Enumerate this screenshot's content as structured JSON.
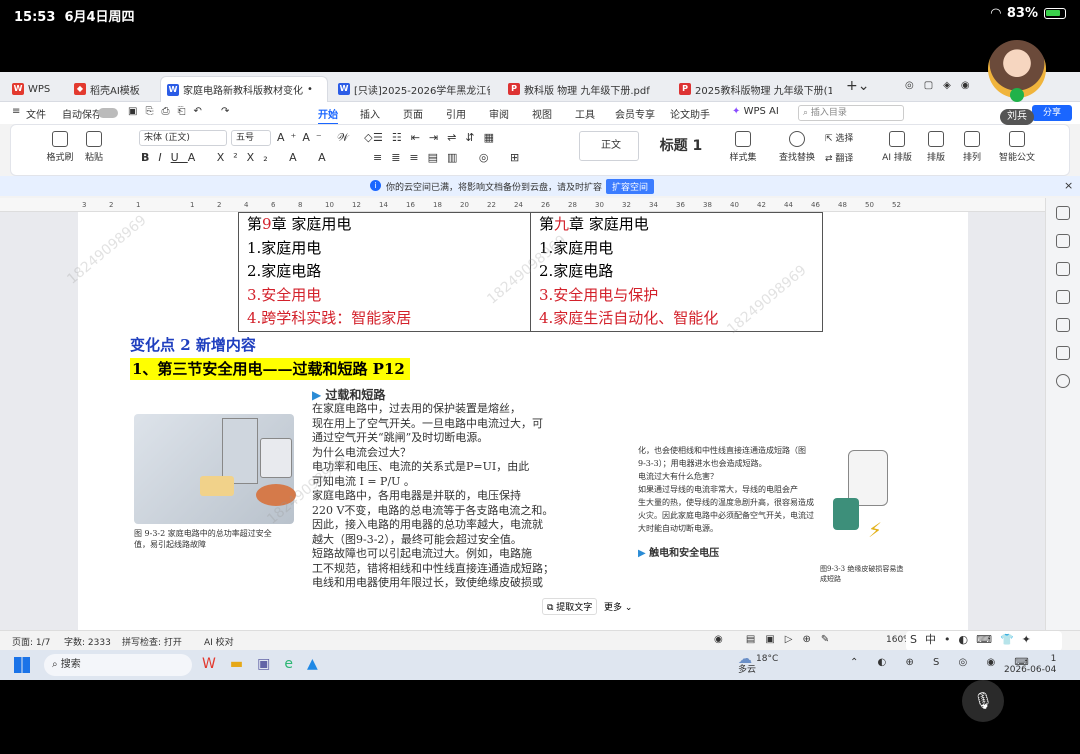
{
  "ipad": {
    "time": "15:53",
    "date": "6月4日周四",
    "battery": "83%",
    "user_name": "刘兵"
  },
  "tabs": [
    {
      "label": "WPS",
      "color": "#e33a2f",
      "active": false
    },
    {
      "label": "稻壳AI模板",
      "color": "#e33a2f",
      "active": false
    },
    {
      "label": "家庭电路新教科版教材变化",
      "color": "#2b5ce6",
      "active": true
    },
    {
      "label": "[只读]2025-2026学年黑龙江省哈尔",
      "color": "#2b5ce6",
      "active": false
    },
    {
      "label": "教科版  物理  九年级下册.pdf",
      "color": "#d33",
      "active": false
    },
    {
      "label": "2025教科版物理  九年级下册(1).pdf",
      "color": "#d33",
      "active": false
    }
  ],
  "menu": {
    "file": "文件",
    "autosave": "自动保存",
    "items": [
      "开始",
      "插入",
      "页面",
      "引用",
      "审阅",
      "视图",
      "工具",
      "会员专享",
      "论文助手"
    ],
    "wps_ai": "WPS AI",
    "search_placeholder": "插入目录",
    "share": "分享"
  },
  "ribbon": {
    "format_painter": "格式刷",
    "paste": "粘贴",
    "font": "宋体 (正文)",
    "size": "五号",
    "style_normal": "正文",
    "style_heading": "标题 1",
    "style_set": "样式集",
    "find_replace": "查找替换",
    "select": "选择",
    "translate": "翻译",
    "ai_layout": "AI 排版",
    "layout": "排版",
    "arrange": "排列",
    "smart_doc": "智能公文"
  },
  "notice": {
    "text": "你的云空间已满，将影响文档备份到云盘，请及时扩容",
    "button": "扩容空间"
  },
  "ruler_numbers": [
    "3",
    "2",
    "1",
    "",
    "1",
    "2",
    "4",
    "6",
    "8",
    "10",
    "12",
    "14",
    "16",
    "18",
    "20",
    "22",
    "24",
    "26",
    "28",
    "30",
    "32",
    "34",
    "36",
    "38",
    "40",
    "42",
    "44",
    "46",
    "48",
    "50",
    "52"
  ],
  "doc": {
    "old_chapter": {
      "prefix": "第",
      "num": "9",
      "suffix": "章  家庭用电",
      "items": [
        "1.家庭用电",
        "2.家庭电路"
      ],
      "red_items": [
        "3.安全用电",
        "4.跨学科实践：智能家居"
      ]
    },
    "new_chapter": {
      "prefix": "第",
      "num": "九",
      "suffix": "章    家庭用电",
      "items": [
        "1.家庭用电",
        "2.家庭电路"
      ],
      "red_items": [
        "3.安全用电与保护",
        "4.家庭生活自动化、智能化"
      ]
    },
    "change_point": "变化点 2    新增内容",
    "highlight": "1、第三节安全用电——过载和短路  P12",
    "scan_title": "过载和短路",
    "scan_lines": [
      "在家庭电路中，过去用的保护装置是熔丝，",
      "现在用上了空气开关。一旦电路中电流过大，可",
      "通过空气开关“跳闸”及时切断电源。",
      "为什么电流会过大？",
      "电功率和电压、电流的关系式是P=UI，由此",
      "可知电流 I = P/U 。",
      "家庭电路中，各用电器是并联的，电压保持",
      "220 V不变，电路的总电流等于各支路电流之和。",
      "因此，接入电路的用电器的总功率越大，电流就",
      "越大（图9-3-2），最终可能会超过安全值。",
      "短路故障也可以引起电流过大。例如，电路施",
      "工不规范，错将相线和中性线直接连通造成短路；",
      "电线和用电器使用年限过长，致使绝缘皮破损或"
    ],
    "fig_caption": "图 9-3-2  家庭电路中的总功率超过安全值，易引起线路故障",
    "right_lines": [
      "化，也会使相线和中性线直接连通造成短路（图",
      "9-3-3）；用电器进水也会造成短路。",
      "电流过大有什么危害？",
      "如果通过导线的电流非常大，导线的电阻会产",
      "生大量的热，使导线的温度急剧升高，很容易造成",
      "火灾。因此家庭电路中必须配备空气开关，电流过",
      "大时能自动切断电源。"
    ],
    "right_subheading": "触电和安全电压",
    "right_fig_caption": "图9-3-3  绝缘皮破损容易造成短路",
    "extract_text": "提取文字",
    "more": "更多",
    "watermark": "18249098969"
  },
  "status": {
    "page": "页面: 1/7",
    "words": "字数: 2333",
    "spell": "拼写检查: 打开",
    "ai_check": "AI 校对",
    "zoom": "160%"
  },
  "taskbar": {
    "search": "搜索",
    "weather_temp": "18°C",
    "weather_desc": "多云",
    "ime": "中",
    "date": "2026-06-04",
    "time": "1"
  }
}
